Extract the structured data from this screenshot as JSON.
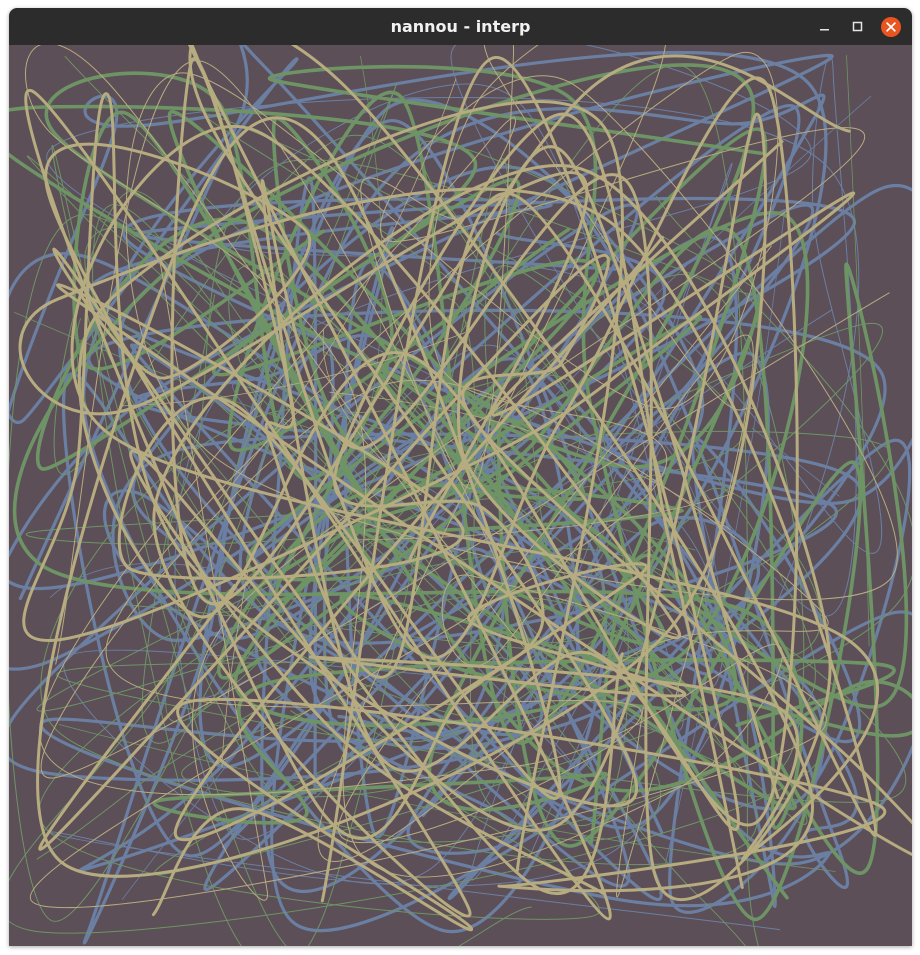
{
  "window": {
    "title": "nannou - interp",
    "controls": {
      "minimize": "minimize-icon",
      "maximize": "maximize-icon",
      "close": "close-icon"
    }
  },
  "sketch": {
    "background_color": "#5c4f57",
    "stroke_colors": [
      "#6b7fa3",
      "#6e9466",
      "#b7ab80"
    ]
  }
}
